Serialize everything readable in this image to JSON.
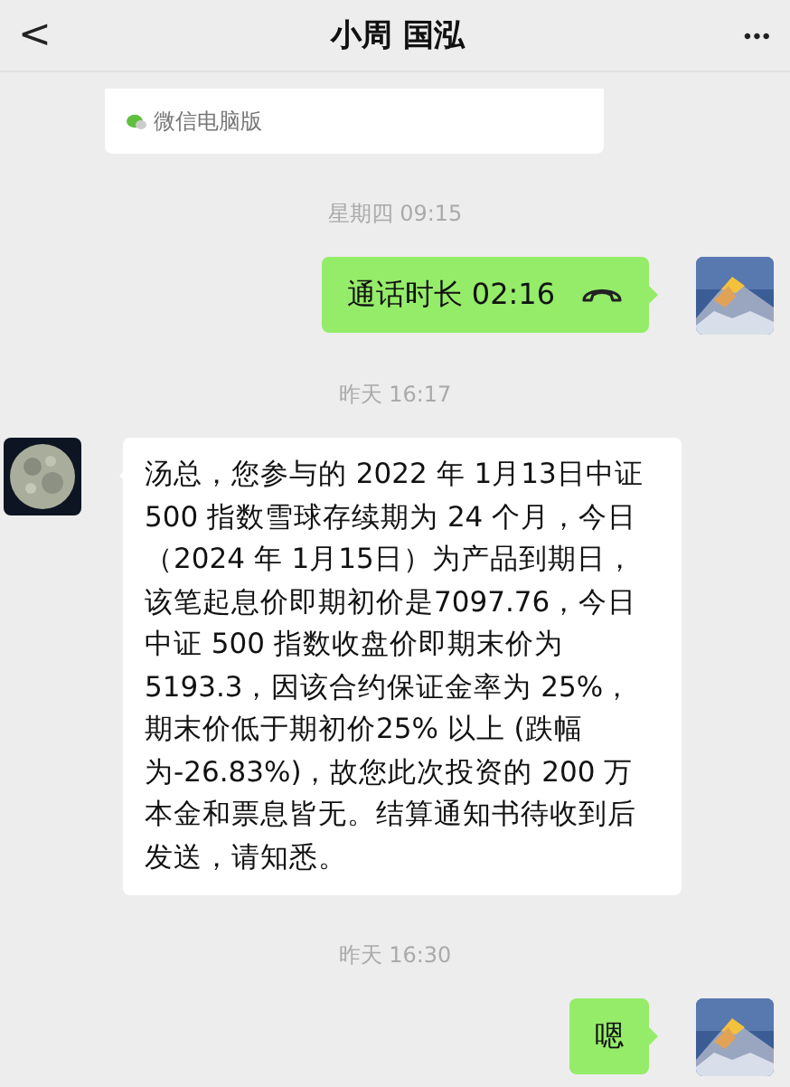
{
  "header": {
    "back": "<",
    "title": "小周 国泓",
    "more": "•••"
  },
  "messages": [
    {
      "kind": "card",
      "label": "微信电脑版"
    },
    {
      "kind": "time",
      "text": "星期四 09:15"
    },
    {
      "kind": "call",
      "sent": true,
      "text": "通话时长 02:16"
    },
    {
      "kind": "time",
      "text": "昨天 16:17"
    },
    {
      "kind": "text",
      "sent": false,
      "text": "汤总，您参与的 2022 年 1月13日中证 500 指数雪球存续期为 24 个月，今日（2024 年 1月15日）为产品到期日，该笔起息价即期初价是7097.76，今日中证 500 指数收盘价即期末价为 5193.3，因该合约保证金率为 25%，期末价低于期初价25% 以上 (跌幅为-26.83%)，故您此次投资的 200 万本金和票息皆无。结算通知书待收到后发送，请知悉。"
    },
    {
      "kind": "time",
      "text": "昨天 16:30"
    },
    {
      "kind": "text",
      "sent": true,
      "text": "嗯"
    }
  ]
}
